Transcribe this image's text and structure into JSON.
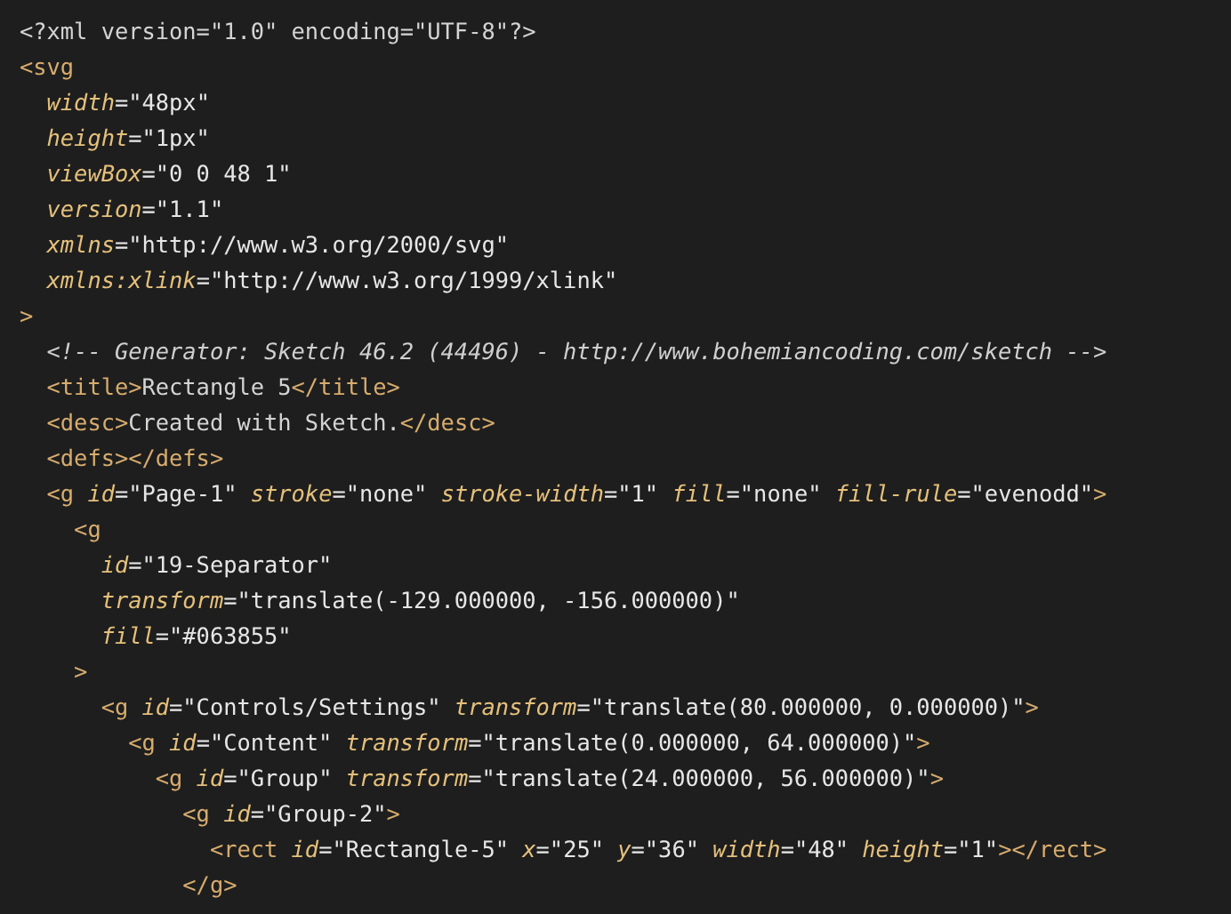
{
  "code_lines": [
    [
      {
        "kind": "plain",
        "text": "<?xml version=\"1.0\" encoding=\"UTF-8\"?>"
      }
    ],
    [
      {
        "kind": "tag",
        "text": "<svg"
      }
    ],
    [
      {
        "kind": "attr",
        "text": "  width"
      },
      {
        "kind": "value",
        "text": "=\"48px\""
      }
    ],
    [
      {
        "kind": "attr",
        "text": "  height"
      },
      {
        "kind": "value",
        "text": "=\"1px\""
      }
    ],
    [
      {
        "kind": "attr",
        "text": "  viewBox"
      },
      {
        "kind": "value",
        "text": "=\"0 0 48 1\""
      }
    ],
    [
      {
        "kind": "attr",
        "text": "  version"
      },
      {
        "kind": "value",
        "text": "=\"1.1\""
      }
    ],
    [
      {
        "kind": "attr",
        "text": "  xmlns"
      },
      {
        "kind": "value",
        "text": "=\"http://www.w3.org/2000/svg\""
      }
    ],
    [
      {
        "kind": "attr",
        "text": "  xmlns:xlink"
      },
      {
        "kind": "value",
        "text": "=\"http://www.w3.org/1999/xlink\""
      }
    ],
    [
      {
        "kind": "tag",
        "text": ">"
      }
    ],
    [
      {
        "kind": "comment",
        "text": "  <!-- Generator: Sketch 46.2 (44496) - http://www.bohemiancoding.com/sketch -->"
      }
    ],
    [
      {
        "kind": "tag",
        "text": "  <title>"
      },
      {
        "kind": "plain",
        "text": "Rectangle 5"
      },
      {
        "kind": "tag",
        "text": "</title>"
      }
    ],
    [
      {
        "kind": "tag",
        "text": "  <desc>"
      },
      {
        "kind": "plain",
        "text": "Created with Sketch."
      },
      {
        "kind": "tag",
        "text": "</desc>"
      }
    ],
    [
      {
        "kind": "tag",
        "text": "  <defs></defs>"
      }
    ],
    [
      {
        "kind": "tag",
        "text": "  <g"
      },
      {
        "kind": "attr",
        "text": " id"
      },
      {
        "kind": "value",
        "text": "=\"Page-1\""
      },
      {
        "kind": "attr",
        "text": " stroke"
      },
      {
        "kind": "value",
        "text": "=\"none\""
      },
      {
        "kind": "attr",
        "text": " stroke-width"
      },
      {
        "kind": "value",
        "text": "=\"1\""
      },
      {
        "kind": "attr",
        "text": " fill"
      },
      {
        "kind": "value",
        "text": "=\"none\""
      },
      {
        "kind": "attr",
        "text": " fill-rule"
      },
      {
        "kind": "value",
        "text": "=\"evenodd\""
      },
      {
        "kind": "tag",
        "text": ">"
      }
    ],
    [
      {
        "kind": "tag",
        "text": "    <g"
      }
    ],
    [
      {
        "kind": "attr",
        "text": "      id"
      },
      {
        "kind": "value",
        "text": "=\"19-Separator\""
      }
    ],
    [
      {
        "kind": "attr",
        "text": "      transform"
      },
      {
        "kind": "value",
        "text": "=\"translate(-129.000000, -156.000000)\""
      }
    ],
    [
      {
        "kind": "attr",
        "text": "      fill"
      },
      {
        "kind": "value",
        "text": "=\"#063855\""
      }
    ],
    [
      {
        "kind": "tag",
        "text": "    >"
      }
    ],
    [
      {
        "kind": "tag",
        "text": "      <g"
      },
      {
        "kind": "attr",
        "text": " id"
      },
      {
        "kind": "value",
        "text": "=\"Controls/Settings\""
      },
      {
        "kind": "attr",
        "text": " transform"
      },
      {
        "kind": "value",
        "text": "=\"translate(80.000000, 0.000000)\""
      },
      {
        "kind": "tag",
        "text": ">"
      }
    ],
    [
      {
        "kind": "tag",
        "text": "        <g"
      },
      {
        "kind": "attr",
        "text": " id"
      },
      {
        "kind": "value",
        "text": "=\"Content\""
      },
      {
        "kind": "attr",
        "text": " transform"
      },
      {
        "kind": "value",
        "text": "=\"translate(0.000000, 64.000000)\""
      },
      {
        "kind": "tag",
        "text": ">"
      }
    ],
    [
      {
        "kind": "tag",
        "text": "          <g"
      },
      {
        "kind": "attr",
        "text": " id"
      },
      {
        "kind": "value",
        "text": "=\"Group\""
      },
      {
        "kind": "attr",
        "text": " transform"
      },
      {
        "kind": "value",
        "text": "=\"translate(24.000000, 56.000000)\""
      },
      {
        "kind": "tag",
        "text": ">"
      }
    ],
    [
      {
        "kind": "tag",
        "text": "            <g"
      },
      {
        "kind": "attr",
        "text": " id"
      },
      {
        "kind": "value",
        "text": "=\"Group-2\""
      },
      {
        "kind": "tag",
        "text": ">"
      }
    ],
    [
      {
        "kind": "tag",
        "text": "              <rect"
      },
      {
        "kind": "attr",
        "text": " id"
      },
      {
        "kind": "value",
        "text": "=\"Rectangle-5\""
      },
      {
        "kind": "attr",
        "text": " x"
      },
      {
        "kind": "value",
        "text": "=\"25\""
      },
      {
        "kind": "attr",
        "text": " y"
      },
      {
        "kind": "value",
        "text": "=\"36\""
      },
      {
        "kind": "attr",
        "text": " width"
      },
      {
        "kind": "value",
        "text": "=\"48\""
      },
      {
        "kind": "attr",
        "text": " height"
      },
      {
        "kind": "value",
        "text": "=\"1\""
      },
      {
        "kind": "tag",
        "text": "></rect>"
      }
    ],
    [
      {
        "kind": "tag",
        "text": "            </g>"
      }
    ]
  ]
}
